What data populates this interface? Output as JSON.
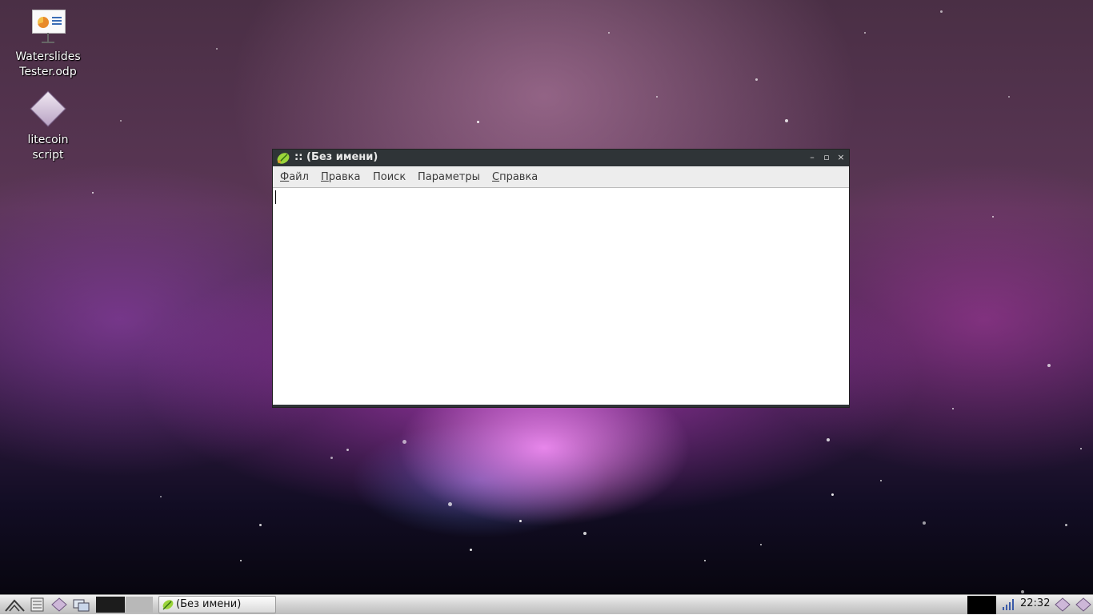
{
  "desktop": {
    "icons": [
      {
        "label_line1": "Waterslides",
        "label_line2": "Tester.odp",
        "icon": "presentation-file-icon"
      },
      {
        "label_line1": "litecoin",
        "label_line2": "script",
        "icon": "script-file-icon"
      }
    ]
  },
  "window": {
    "title_separator": "::",
    "title": "(Без имени)",
    "app_icon": "leafpad-icon",
    "buttons": {
      "minimize": "–",
      "maximize": "▫",
      "close": "×"
    },
    "menu": [
      {
        "underlined": "Ф",
        "rest": "айл"
      },
      {
        "underlined": "П",
        "rest": "равка"
      },
      {
        "underlined": "",
        "rest": "Поиск"
      },
      {
        "underlined": "",
        "rest": "Параметры"
      },
      {
        "underlined": "С",
        "rest": "правка"
      }
    ],
    "editor_text": ""
  },
  "taskbar": {
    "task_label": "(Без имени)",
    "clock": "22:32",
    "icons": [
      "start-menu-icon",
      "file-manager-icon",
      "script-launcher-icon",
      "show-desktop-icon",
      "network-signal-icon",
      "tray-app-icon"
    ]
  }
}
